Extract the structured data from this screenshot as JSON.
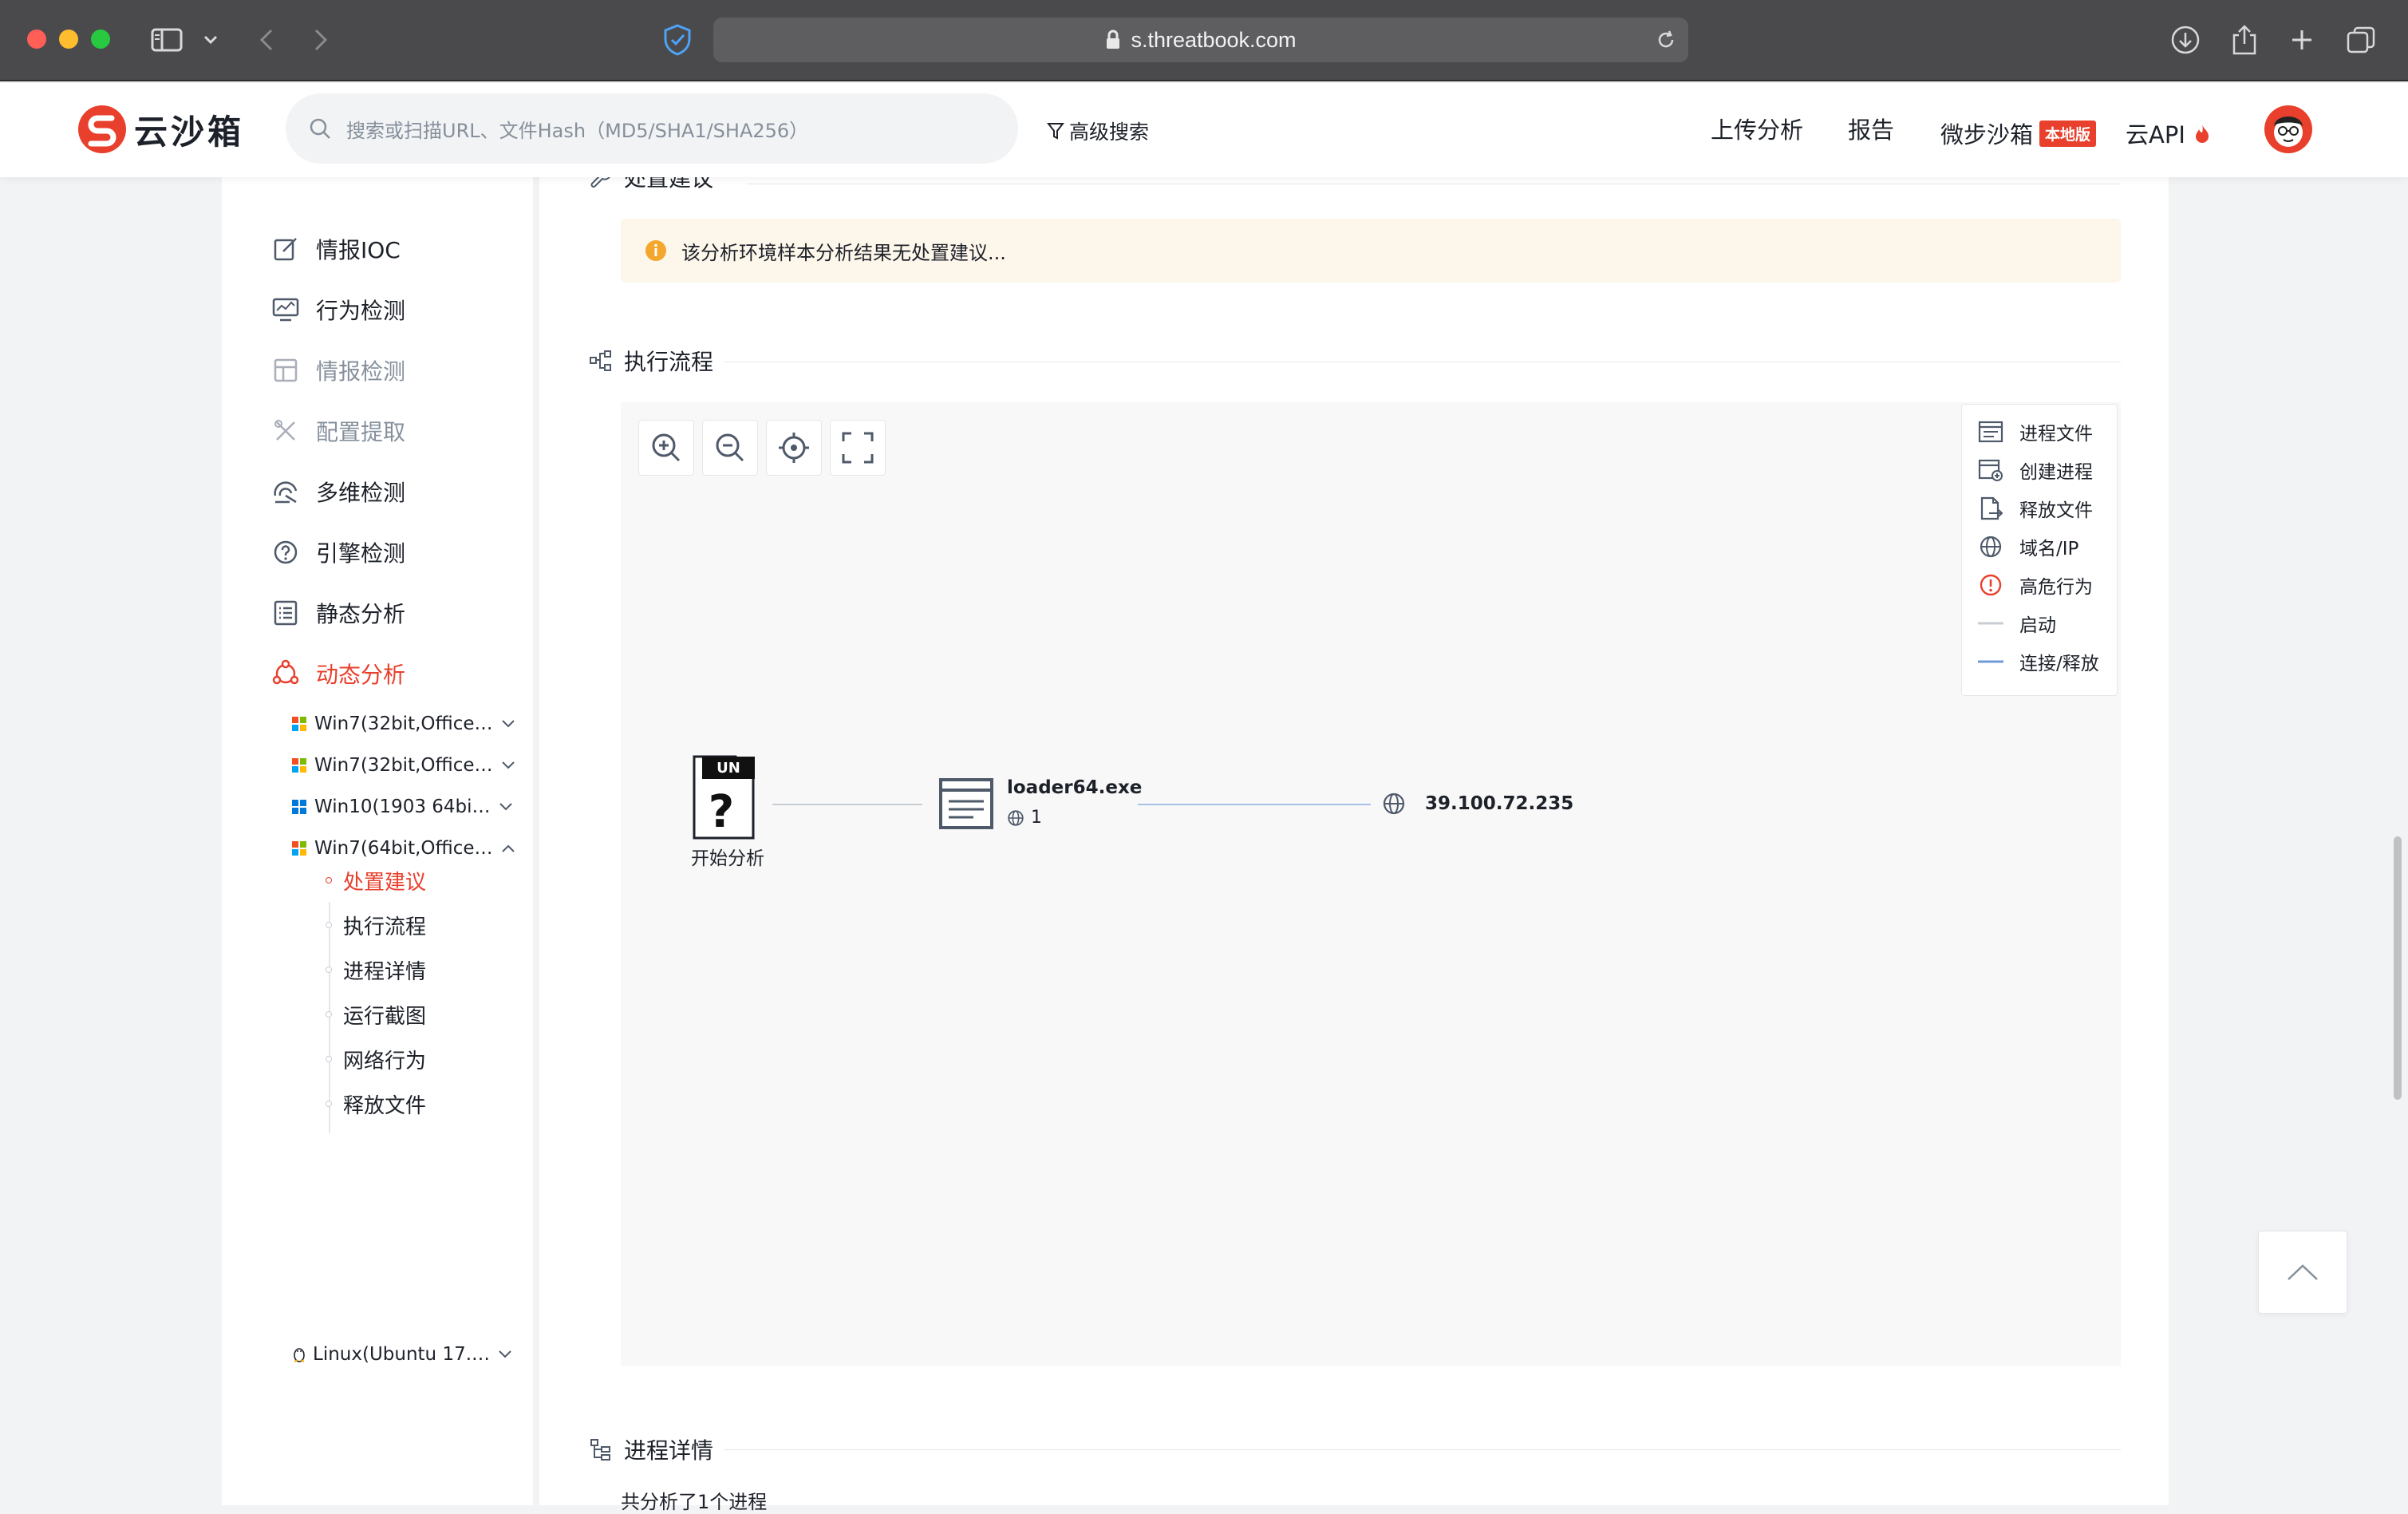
{
  "browser": {
    "url": "s.threatbook.com"
  },
  "brand": {
    "logo_text": "云沙箱",
    "accent": "#e8402c"
  },
  "search": {
    "placeholder": "搜索或扫描URL、文件Hash（MD5/SHA1/SHA256）",
    "advanced_label": "高级搜索"
  },
  "nav": {
    "upload": "上传分析",
    "report": "报告",
    "microstep": "微步沙箱",
    "local_badge": "本地版",
    "cloud_api": "云API"
  },
  "sidebar": {
    "items": [
      {
        "label": "情报IOC",
        "icon": "edit-icon",
        "state": "normal"
      },
      {
        "label": "行为检测",
        "icon": "monitor-chart-icon",
        "state": "normal"
      },
      {
        "label": "情报检测",
        "icon": "layout-icon",
        "state": "disabled"
      },
      {
        "label": "配置提取",
        "icon": "tools-icon",
        "state": "disabled"
      },
      {
        "label": "多维检测",
        "icon": "radar-icon",
        "state": "normal"
      },
      {
        "label": "引擎检测",
        "icon": "question-circle-icon",
        "state": "normal"
      },
      {
        "label": "静态分析",
        "icon": "list-icon",
        "state": "normal"
      },
      {
        "label": "动态分析",
        "icon": "network-icon",
        "state": "active"
      }
    ],
    "environments": [
      {
        "label": "Win7(32bit,Office…",
        "os": "windows7"
      },
      {
        "label": "Win7(32bit,Office…",
        "os": "windows7"
      },
      {
        "label": "Win10(1903 64bi…",
        "os": "windows10"
      },
      {
        "label": "Win7(64bit,Office…",
        "os": "windows7"
      },
      {
        "label": "Linux(Ubuntu 17.…",
        "os": "linux"
      }
    ],
    "subitems": [
      "处置建议",
      "执行流程",
      "进程详情",
      "运行截图",
      "网络行为",
      "释放文件"
    ]
  },
  "sections": {
    "disposal": {
      "title": "处置建议",
      "notice": "该分析环境样本分析结果无处置建议..."
    },
    "flow": {
      "title": "执行流程"
    },
    "process": {
      "title": "进程详情",
      "summary": "共分析了1个进程"
    }
  },
  "graph": {
    "start_badge": "UN",
    "start_label": "开始分析",
    "process_name": "loader64.exe",
    "process_net_count": "1",
    "ip": "39.100.72.235"
  },
  "legend": [
    {
      "label": "进程文件",
      "icon": "process-file-icon"
    },
    {
      "label": "创建进程",
      "icon": "create-process-icon"
    },
    {
      "label": "释放文件",
      "icon": "release-file-icon"
    },
    {
      "label": "域名/IP",
      "icon": "globe-icon"
    },
    {
      "label": "高危行为",
      "icon": "alert-icon"
    },
    {
      "label": "启动",
      "icon": "start-line"
    },
    {
      "label": "连接/释放",
      "icon": "connect-line"
    }
  ],
  "colors": {
    "active": "#e8402c",
    "disabled": "#86909c",
    "notice_bg": "#fdf6ea",
    "connect_line": "#6e9bd7"
  }
}
